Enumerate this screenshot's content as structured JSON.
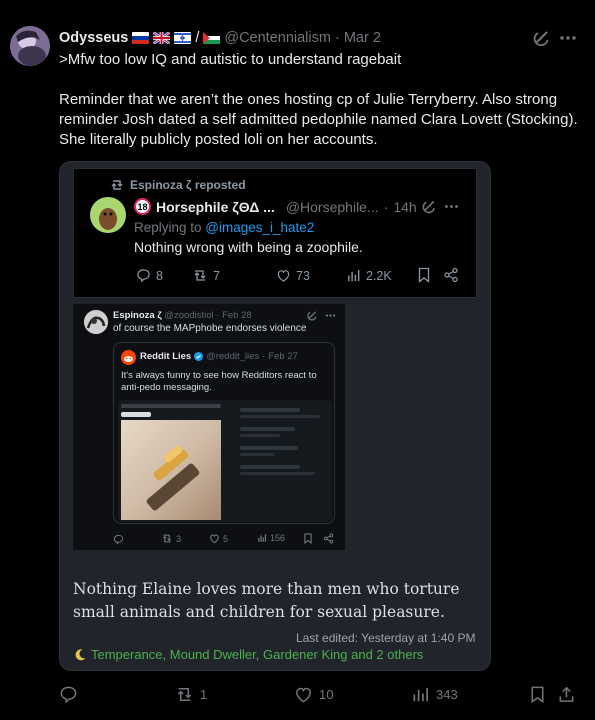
{
  "tweet": {
    "display_name": "Odysseus",
    "handle": "@Centennialism",
    "separator": "·",
    "date": "Mar 2",
    "flag_slash": "/",
    "lines": [
      ">Mfw too low IQ and autistic to understand ragebait",
      "Reminder that we aren’t the ones hosting cp of Julie Terryberry. Also strong reminder Josh dated a self admitted pedophile named Clara Lovett (Stocking). She literally publicly posted loli on her accounts."
    ],
    "icons": [
      "grok-icon",
      "more-icon"
    ]
  },
  "embedded_tweet_1": {
    "repost_label": "Espinoza ζ reposted",
    "badge": "18",
    "display_name": "Horsephile ζΘΔ ...",
    "handle": "@Horsephile...",
    "separator": "·",
    "time": "14h",
    "replying_prefix": "Replying to ",
    "replying_handle": "@images_i_hate2",
    "text": "Nothing wrong with being a zoophile.",
    "replies": "8",
    "reposts": "7",
    "likes": "73",
    "views": "2.2K"
  },
  "embedded_tweet_2": {
    "display_name": "Espinoza ζ",
    "handle": "@zoodistiol",
    "separator": "·",
    "date": "Feb 28",
    "text": "of course the MAPphobe endorses violence",
    "quoted": {
      "display_name": "Reddit Lies",
      "handle": "@reddit_lies",
      "separator": "·",
      "date": "Feb 27",
      "text": "It's always funny to see how Redditors react to anti-pedo messaging."
    },
    "replies": "",
    "reposts": "3",
    "likes": "5",
    "views": "156"
  },
  "caption": "Nothing Elaine loves more than men who torture small animals and children for sexual pleasure.",
  "last_edited": "Last edited: Yesterday at 1:40 PM",
  "reactions": "Temperance, Mound Dweller, Gardener King and 2 others",
  "actions": {
    "replies": "",
    "reposts": "1",
    "likes": "10",
    "views": "343"
  },
  "colors": {
    "background": "#000000",
    "text": "#e7e9ea",
    "muted": "#71767b",
    "link": "#1d9bf0",
    "card": "#21252b",
    "reactions": "#4caf50"
  }
}
